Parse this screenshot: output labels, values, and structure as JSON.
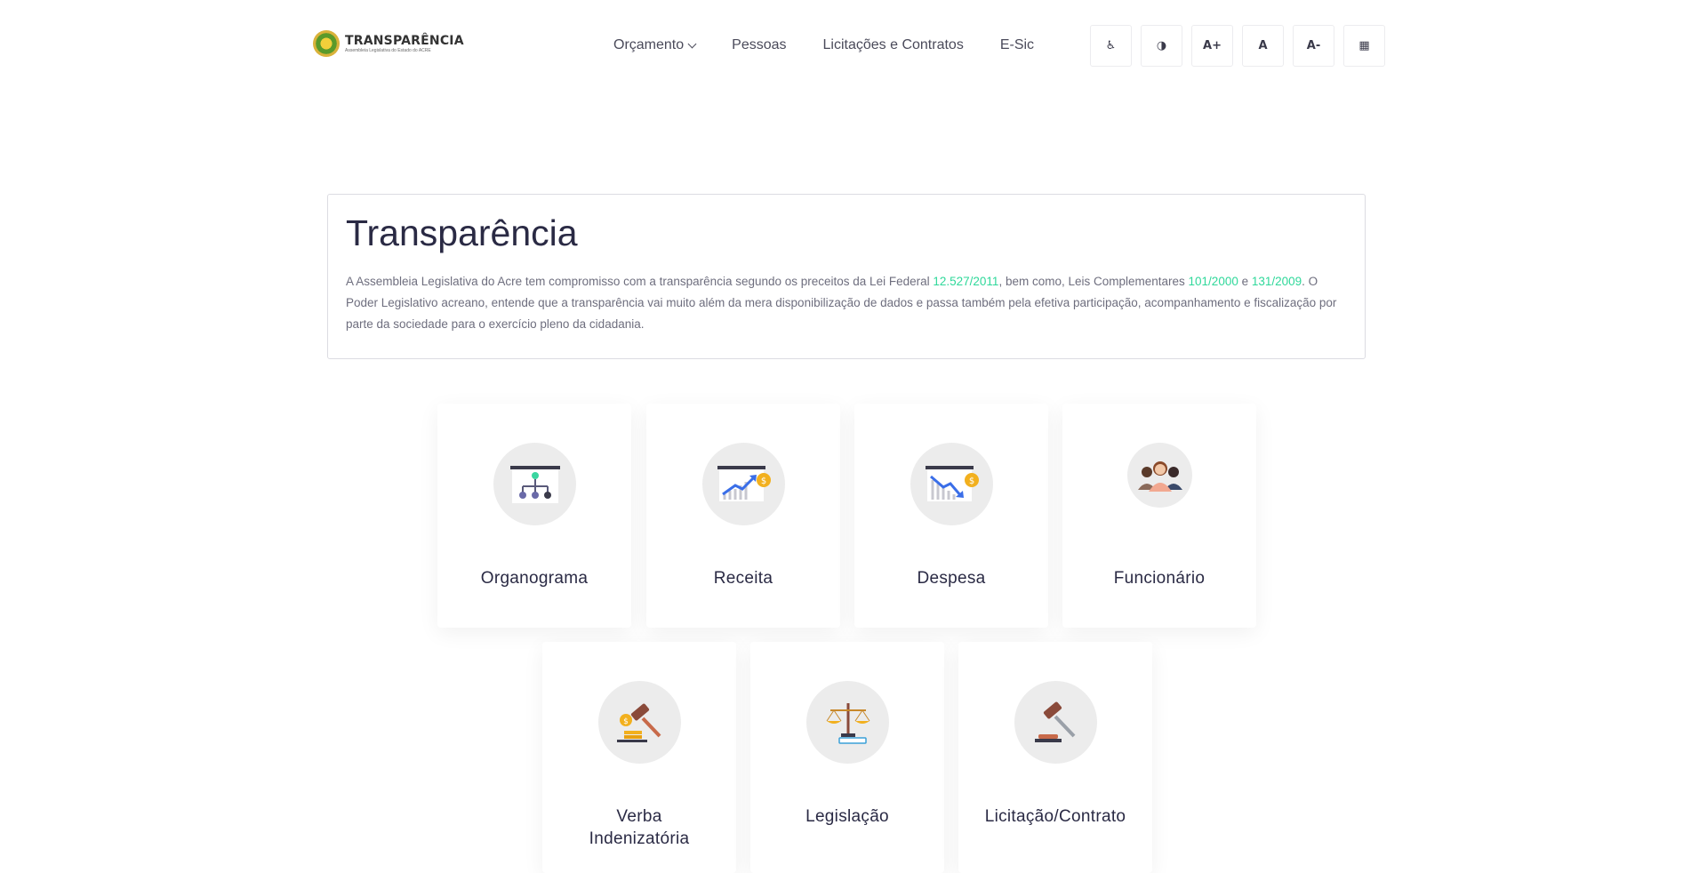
{
  "header": {
    "logo": {
      "title": "TRANSPARÊNCIA",
      "subtitle": "Assembleia Legislativa do Estado do ACRE"
    },
    "nav": [
      {
        "label": "Orçamento",
        "has_dropdown": true
      },
      {
        "label": "Pessoas"
      },
      {
        "label": "Licitações e Contratos"
      },
      {
        "label": "E-Sic"
      }
    ],
    "accessibility": [
      {
        "icon": "wheelchair-icon",
        "label": "♿"
      },
      {
        "icon": "contrast-icon",
        "label": "◑"
      },
      {
        "icon": "font-increase-icon",
        "label": "A+"
      },
      {
        "icon": "font-reset-icon",
        "label": "A"
      },
      {
        "icon": "font-decrease-icon",
        "label": "A-"
      },
      {
        "icon": "sitemap-icon",
        "label": "▦"
      }
    ]
  },
  "intro": {
    "title": "Transparência",
    "text_1": "A Assembleia Legislativa do Acre tem compromisso com a transparência segundo os preceitos da Lei Federal ",
    "link_1": "12.527/2011",
    "text_2": ", bem como, Leis Complementares ",
    "link_2": "101/2000",
    "text_3": " e ",
    "link_3": "131/2009",
    "text_4": ". O Poder Legislativo acreano, entende que a transparência vai muito além da mera disponibilização de dados e passa também pela efetiva participação, acompanhamento e fiscalização por parte da sociedade para o exercício pleno da cidadania.",
    "link_color": "#2fd89a"
  },
  "cards": [
    {
      "label": "Organograma",
      "icon": "org-chart-icon"
    },
    {
      "label": "Receita",
      "icon": "revenue-chart-icon"
    },
    {
      "label": "Despesa",
      "icon": "expense-chart-icon"
    },
    {
      "label": "Funcionário",
      "icon": "people-icon"
    },
    {
      "label_line_1": "Verba",
      "label_line_2": "Indenizatória",
      "icon": "gavel-coins-icon"
    },
    {
      "label": "Legislação",
      "icon": "scales-icon"
    },
    {
      "label": "Licitação/Contrato",
      "icon": "gavel-icon"
    }
  ]
}
